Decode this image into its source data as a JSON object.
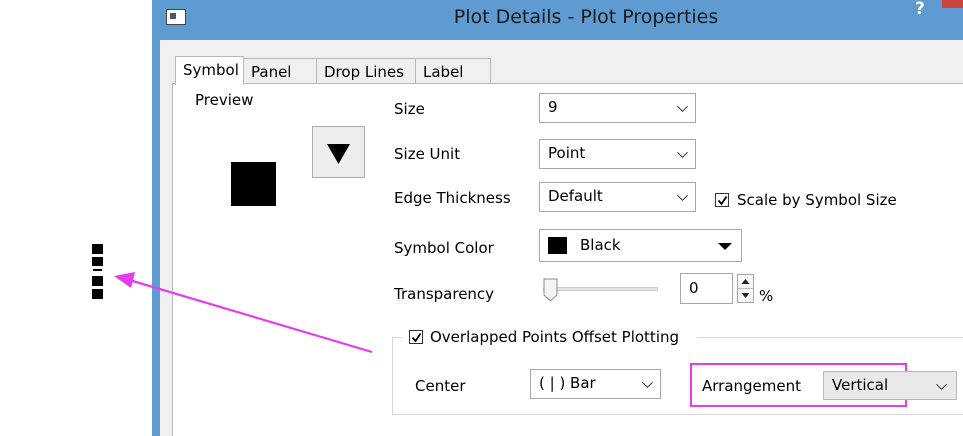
{
  "window": {
    "title": "Plot Details - Plot Properties",
    "help": "?"
  },
  "tabs": [
    {
      "label": "Symbol",
      "active": true
    },
    {
      "label": "Panel"
    },
    {
      "label": "Drop Lines"
    },
    {
      "label": "Label"
    }
  ],
  "preview": {
    "label": "Preview"
  },
  "fields": {
    "size": {
      "label": "Size",
      "value": "9"
    },
    "size_unit": {
      "label": "Size Unit",
      "value": "Point"
    },
    "edge_thickness": {
      "label": "Edge Thickness",
      "value": "Default"
    },
    "scale_by_symbol_size": {
      "label": "Scale by Symbol Size",
      "checked": true
    },
    "symbol_color": {
      "label": "Symbol Color",
      "value": "Black",
      "swatch": "#000000"
    },
    "transparency": {
      "label": "Transparency",
      "value": "0",
      "unit": "%",
      "level": 0
    }
  },
  "overlap": {
    "label": "Overlapped Points Offset Plotting",
    "checked": true,
    "center": {
      "label": "Center",
      "value": "( | ) Bar"
    },
    "arrangement": {
      "label": "Arrangement",
      "value": "Vertical"
    }
  },
  "colors": {
    "title_bar": "#5e9bd0",
    "annotation": "#e63cf0",
    "close_button": "#c9463d"
  }
}
